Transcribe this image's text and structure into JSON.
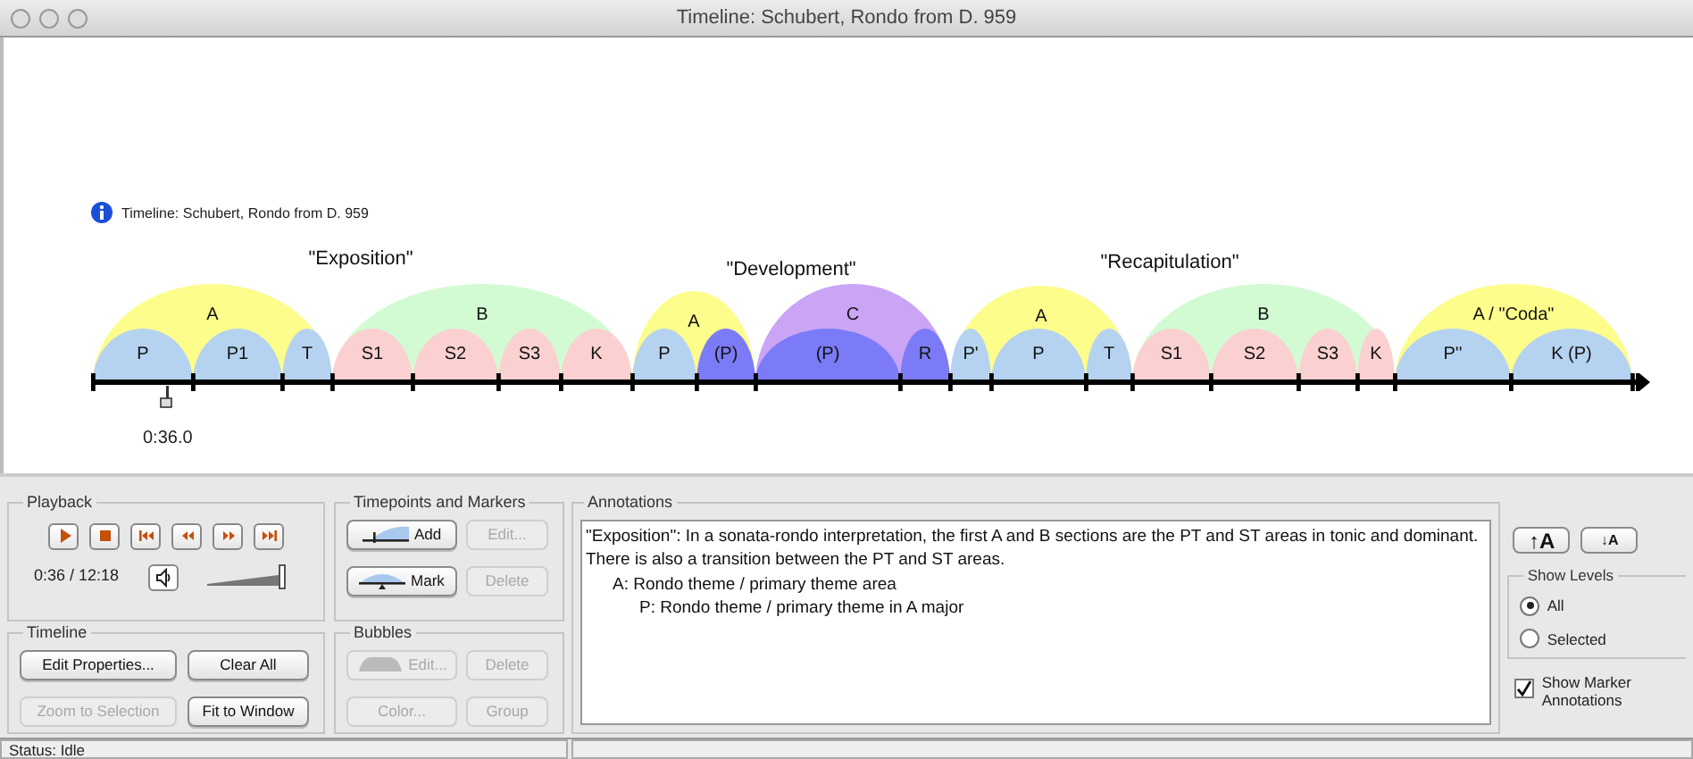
{
  "window": {
    "title": "Timeline: Schubert, Rondo from D. 959"
  },
  "timeline": {
    "info": "Timeline: Schubert, Rondo from D. 959",
    "section_labels": [
      "\"Exposition\"",
      "\"Development\"",
      "\"Recapitulation\""
    ],
    "bubbles": [
      {
        "label": "A",
        "color": "#fdfd8c",
        "children": [
          {
            "label": "P",
            "color": "#b5d3f0"
          },
          {
            "label": "P1",
            "color": "#b5d3f0"
          },
          {
            "label": "T",
            "color": "#b5d3f0"
          }
        ]
      },
      {
        "label": "B",
        "color": "#d3fbd3",
        "children": [
          {
            "label": "S1",
            "color": "#fbd0d0"
          },
          {
            "label": "S2",
            "color": "#fbd0d0"
          },
          {
            "label": "S3",
            "color": "#fbd0d0"
          },
          {
            "label": "K",
            "color": "#fbd0d0"
          }
        ]
      },
      {
        "label": "A",
        "color": "#fdfd8c",
        "children": [
          {
            "label": "P",
            "color": "#b5d3f0"
          },
          {
            "label": "(P)",
            "color": "#7b7bf7"
          }
        ]
      },
      {
        "label": "C",
        "color": "#caa4f5",
        "children": [
          {
            "label": "(P)",
            "color": "#7b7bf7"
          },
          {
            "label": "R",
            "color": "#7b7bf7"
          }
        ]
      },
      {
        "label": "A",
        "color": "#fdfd8c",
        "children": [
          {
            "label": "P'",
            "color": "#b5d3f0"
          },
          {
            "label": "P",
            "color": "#b5d3f0"
          },
          {
            "label": "T",
            "color": "#b5d3f0"
          }
        ]
      },
      {
        "label": "B",
        "color": "#d3fbd3",
        "children": [
          {
            "label": "S1",
            "color": "#fbd0d0"
          },
          {
            "label": "S2",
            "color": "#fbd0d0"
          },
          {
            "label": "S3",
            "color": "#fbd0d0"
          },
          {
            "label": "K",
            "color": "#fbd0d0"
          }
        ]
      },
      {
        "label": "A / \"Coda\"",
        "color": "#fdfd8c",
        "children": [
          {
            "label": "P''",
            "color": "#b5d3f0"
          },
          {
            "label": "K (P)",
            "color": "#b5d3f0"
          }
        ]
      }
    ],
    "marker_time": "0:36.0"
  },
  "playback": {
    "title": "Playback",
    "transport": [
      {
        "kind": "play"
      },
      {
        "kind": "stop"
      },
      {
        "kind": "start"
      },
      {
        "kind": "rewind"
      },
      {
        "kind": "forward"
      },
      {
        "kind": "end"
      }
    ],
    "time": "0:36 / 12:18",
    "volume": {
      "level": 1
    }
  },
  "timepoints": {
    "title": "Timepoints and Markers",
    "buttons": [
      {
        "kind": "add",
        "label": "Add",
        "disabled": false
      },
      {
        "kind": "plain",
        "label": "Edit...",
        "disabled": true
      },
      {
        "kind": "mark",
        "label": "Mark",
        "disabled": false
      },
      {
        "kind": "plain",
        "label": "Delete",
        "disabled": true
      }
    ]
  },
  "timeline_panel": {
    "title": "Timeline",
    "buttons": [
      {
        "label": "Edit Properties...",
        "disabled": false
      },
      {
        "label": "Clear All",
        "disabled": false
      },
      {
        "label": "Zoom to Selection",
        "disabled": true
      },
      {
        "label": "Fit to Window",
        "disabled": false
      }
    ]
  },
  "bubbles_panel": {
    "title": "Bubbles",
    "buttons": [
      {
        "kind": "bubble",
        "label": "Edit...",
        "disabled": true
      },
      {
        "kind": "plain",
        "label": "Delete",
        "disabled": true
      },
      {
        "kind": "plain",
        "label": "Color...",
        "disabled": true
      },
      {
        "kind": "plain",
        "label": "Group",
        "disabled": true
      }
    ]
  },
  "annotations": {
    "title": "Annotations",
    "paragraph": "\"Exposition\": In a sonata-rondo interpretation, the first A and B sections are the PT and ST areas in tonic and dominant. There is also a transition between the PT and ST areas.",
    "items": [
      {
        "text": "A: Rondo theme / primary theme area",
        "children": [
          {
            "text": "P: Rondo theme / primary theme in A major"
          }
        ]
      }
    ]
  },
  "font_buttons": [
    {
      "kind": "up",
      "label": "↑A"
    },
    {
      "kind": "down",
      "label": "↓A"
    }
  ],
  "show_levels": {
    "title": "Show Levels",
    "options": [
      {
        "label": "All",
        "selected": true
      },
      {
        "label": "Selected",
        "selected": false
      }
    ]
  },
  "show_marker_annotations": {
    "label": "Show Marker Annotations",
    "checked": true
  },
  "status_bar": {
    "text": "Status: Idle"
  }
}
